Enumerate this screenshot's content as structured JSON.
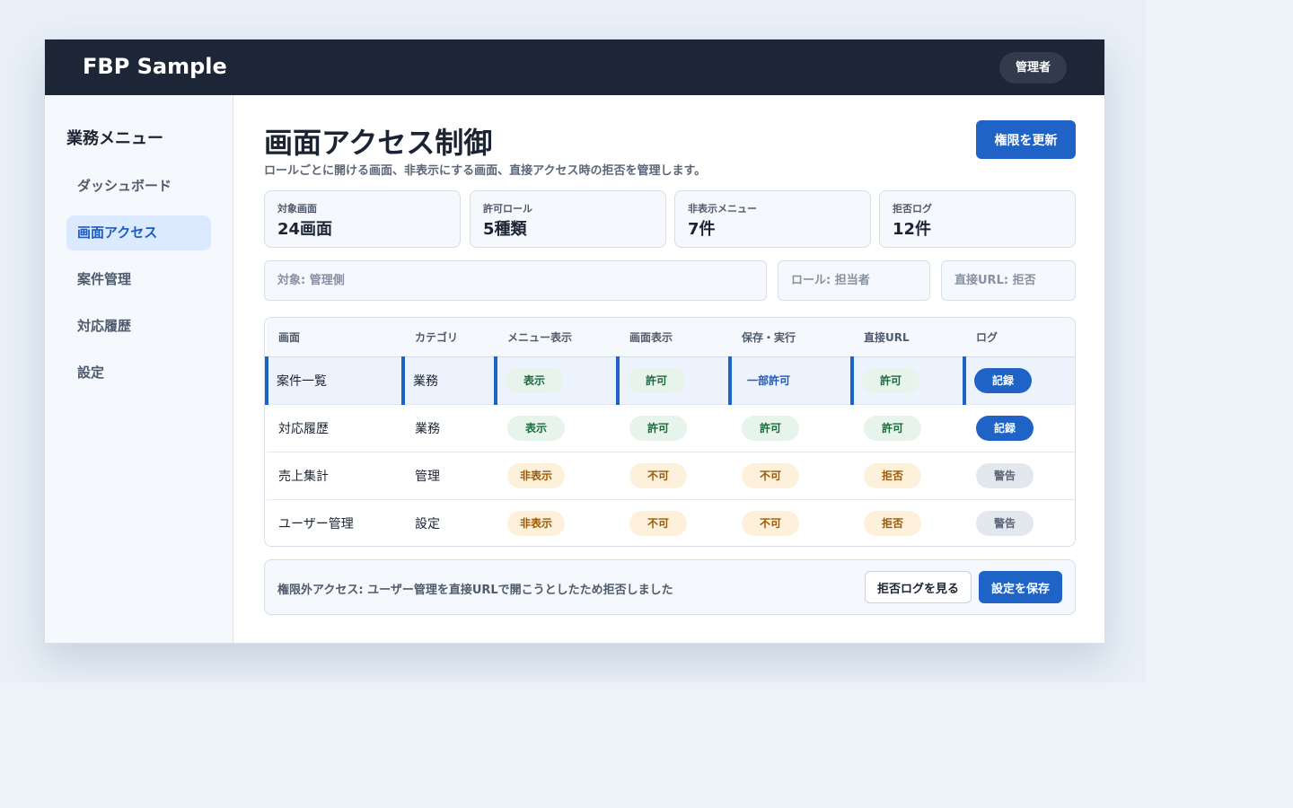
{
  "app": {
    "brand": "FBP Sample",
    "role": "管理者"
  },
  "sidebar": {
    "title": "業務メニュー",
    "items": [
      {
        "label": "ダッシュボード"
      },
      {
        "label": "画面アクセス"
      },
      {
        "label": "案件管理"
      },
      {
        "label": "対応履歴"
      },
      {
        "label": "設定"
      }
    ]
  },
  "header": {
    "title": "画面アクセス制御",
    "description": "ロールごとに開ける画面、非表示にする画面、直接アクセス時の拒否を管理します。",
    "update_label": "権限を更新"
  },
  "stats": [
    {
      "label": "対象画面",
      "value": "24画面"
    },
    {
      "label": "許可ロール",
      "value": "5種類"
    },
    {
      "label": "非表示メニュー",
      "value": "7件"
    },
    {
      "label": "拒否ログ",
      "value": "12件"
    }
  ],
  "filters": {
    "target": "対象: 管理側",
    "role": "ロール: 担当者",
    "direct_url": "直接URL: 拒否"
  },
  "table": {
    "columns": [
      "画面",
      "カテゴリ",
      "メニュー表示",
      "画面表示",
      "保存・実行",
      "直接URL",
      "ログ"
    ],
    "rows": [
      {
        "screen": "案件一覧",
        "category": "業務",
        "menu": "表示",
        "view": "許可",
        "save": "一部許可",
        "url": "許可",
        "log": "記録"
      },
      {
        "screen": "対応履歴",
        "category": "業務",
        "menu": "表示",
        "view": "許可",
        "save": "許可",
        "url": "許可",
        "log": "記録"
      },
      {
        "screen": "売上集計",
        "category": "管理",
        "menu": "非表示",
        "view": "不可",
        "save": "不可",
        "url": "拒否",
        "log": "警告"
      },
      {
        "screen": "ユーザー管理",
        "category": "設定",
        "menu": "非表示",
        "view": "不可",
        "save": "不可",
        "url": "拒否",
        "log": "警告"
      }
    ]
  },
  "alert": {
    "text": "権限外アクセス: ユーザー管理を直接URLで開こうとしたため拒否しました",
    "view_log_label": "拒否ログを見る",
    "save_label": "設定を保存"
  },
  "colors": {
    "topbar": "#1d2636",
    "accent": "#1f63c6",
    "allowed": "#1c6b3d",
    "denied": "#9a5a06"
  }
}
